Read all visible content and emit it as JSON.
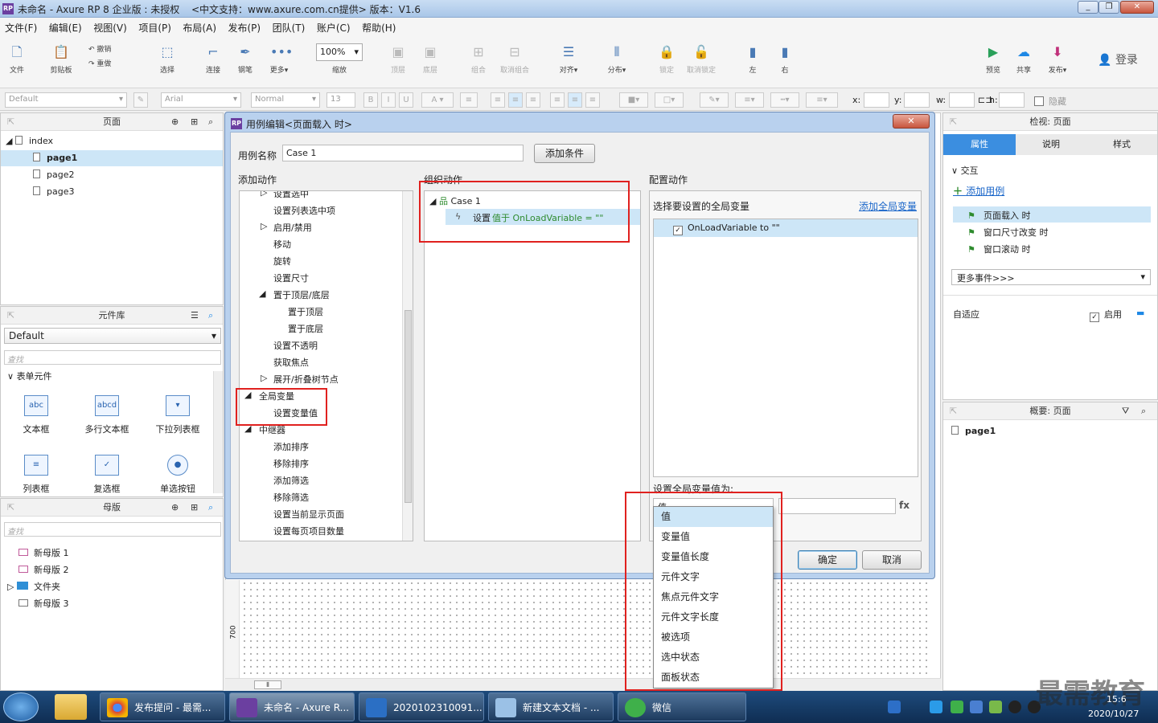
{
  "window": {
    "title": "未命名 - Axure RP 8 企业版 : 未授权",
    "subtitle": "<中文支持：www.axure.com.cn提供> 版本：V1.6"
  },
  "menu": [
    "文件(F)",
    "编辑(E)",
    "视图(V)",
    "项目(P)",
    "布局(A)",
    "发布(P)",
    "团队(T)",
    "账户(C)",
    "帮助(H)"
  ],
  "toolbar": {
    "file": "文件",
    "clipboard": "剪贴板",
    "undo": "撤销",
    "redo": "重做",
    "select": "选择",
    "connect": "连接",
    "pen": "钢笔",
    "more": "更多▾",
    "zoom_value": "100%",
    "zoom": "缩放",
    "top": "顶层",
    "bottom": "底层",
    "group": "组合",
    "ungroup": "取消组合",
    "align": "对齐▾",
    "distribute": "分布▾",
    "lock": "锁定",
    "unlock": "取消锁定",
    "left": "左",
    "right": "右",
    "preview": "预览",
    "share": "共享",
    "publish": "发布▾",
    "login": "登录"
  },
  "format": {
    "style": "Default",
    "font": "Arial",
    "weight": "Normal",
    "size": "13",
    "x": "x:",
    "y": "y:",
    "w": "w:",
    "h": "h:",
    "hide": "隐藏"
  },
  "pages_panel": {
    "title": "页面",
    "root": "index",
    "pages": [
      "page1",
      "page2",
      "page3"
    ]
  },
  "library_panel": {
    "title": "元件库",
    "selected": "Default",
    "search_placeholder": "查找",
    "group": "表单元件",
    "widgets": [
      {
        "label": "文本框",
        "icon": "abc"
      },
      {
        "label": "多行文本框",
        "icon": "abcd"
      },
      {
        "label": "下拉列表框",
        "icon": "▾"
      },
      {
        "label": "列表框",
        "icon": "≡"
      },
      {
        "label": "复选框",
        "icon": "✓"
      },
      {
        "label": "单选按钮",
        "icon": "●"
      }
    ]
  },
  "masters_panel": {
    "title": "母版",
    "search_placeholder": "查找",
    "items": [
      "新母版 1",
      "新母版 2",
      "文件夹",
      "新母版 3"
    ]
  },
  "dialog": {
    "title": "用例编辑<页面载入 时>",
    "case_name_label": "用例名称",
    "case_name_value": "Case 1",
    "add_condition": "添加条件",
    "add_action_label": "添加动作",
    "organize_label": "组织动作",
    "configure_label": "配置动作",
    "actions": [
      "设置选中",
      "设置列表选中项",
      "启用/禁用",
      "移动",
      "旋转",
      "设置尺寸",
      "置于顶层/底层",
      "置于顶层",
      "置于底层",
      "设置不透明",
      "获取焦点",
      "展开/折叠树节点",
      "全局变量",
      "设置变量值",
      "中继器",
      "添加排序",
      "移除排序",
      "添加筛选",
      "移除筛选",
      "设置当前显示页面",
      "设置每页项目数量"
    ],
    "case_node": "Case 1",
    "action_node_prefix": "设置 ",
    "action_node_detail": "值于 OnLoadVariable = \"\"",
    "select_var_label": "选择要设置的全局变量",
    "add_global_var": "添加全局变量",
    "var_item": "OnLoadVariable to \"\"",
    "set_value_label": "设置全局变量值为:",
    "dropdown_value": "值",
    "fx": "fx",
    "dropdown_options": [
      "值",
      "变量值",
      "变量值长度",
      "元件文字",
      "焦点元件文字",
      "元件文字长度",
      "被选项",
      "选中状态",
      "面板状态"
    ],
    "ok": "确定",
    "cancel": "取消"
  },
  "inspector": {
    "title": "检视: 页面",
    "tabs": [
      "属性",
      "说明",
      "样式"
    ],
    "section": "交互",
    "add_case": "添加用例",
    "events": [
      "页面载入 时",
      "窗口尺寸改变 时",
      "窗口滚动 时"
    ],
    "more_events": "更多事件>>>",
    "adaptive": "自适应",
    "enable": "启用"
  },
  "outline_panel": {
    "title": "概要: 页面",
    "item": "page1"
  },
  "canvas": {
    "ruler_value": "700"
  },
  "taskbar": {
    "tasks": [
      "发布提问 - 最需...",
      "未命名 - Axure R...",
      "2020102310091...",
      "新建文本文档 - ...",
      "微信"
    ],
    "date": "2020/10/27",
    "time_partial": "15:6",
    "watermark": "最需教育"
  },
  "colors": {
    "accent": "#3b8ee0",
    "selection": "#cde6f7",
    "highlight_red": "#e0211f",
    "green_text": "#2e8b2e",
    "link": "#1a66c9"
  }
}
